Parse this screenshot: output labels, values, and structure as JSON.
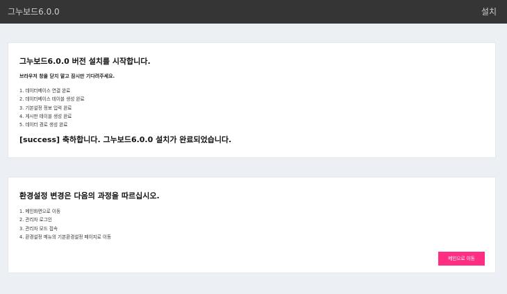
{
  "header": {
    "brand": "그누보드6.0.0",
    "right_label": "설치"
  },
  "install_card": {
    "title": "그누보드6.0.0 버전 설치를 시작합니다.",
    "notice": "브라우저 창을 닫지 말고 잠시만 기다려주세요.",
    "steps": [
      "1. 데이터베이스 연결 완료",
      "2. 데이터베이스 테이블 생성 완료",
      "3. 기본설정 정보 입력 완료",
      "4. 게시판 테이블 생성 완료",
      "5. 데이터 경로 생성 완료"
    ],
    "result": "[success] 축하합니다. 그누보드6.0.0 설치가 완료되었습니다."
  },
  "config_card": {
    "title": "환경설정 변경은 다음의 과정을 따르십시오.",
    "steps": [
      "1. 메인화면으로 이동",
      "2. 관리자 로그인",
      "3. 관리자 모드 접속",
      "4. 환경설정 메뉴의 기본환경설정 페이지로 이동"
    ],
    "button_label": "메인으로 이동"
  },
  "colors": {
    "header_bg": "#353535",
    "page_bg": "#eceff3",
    "accent": "#ff2e82"
  }
}
